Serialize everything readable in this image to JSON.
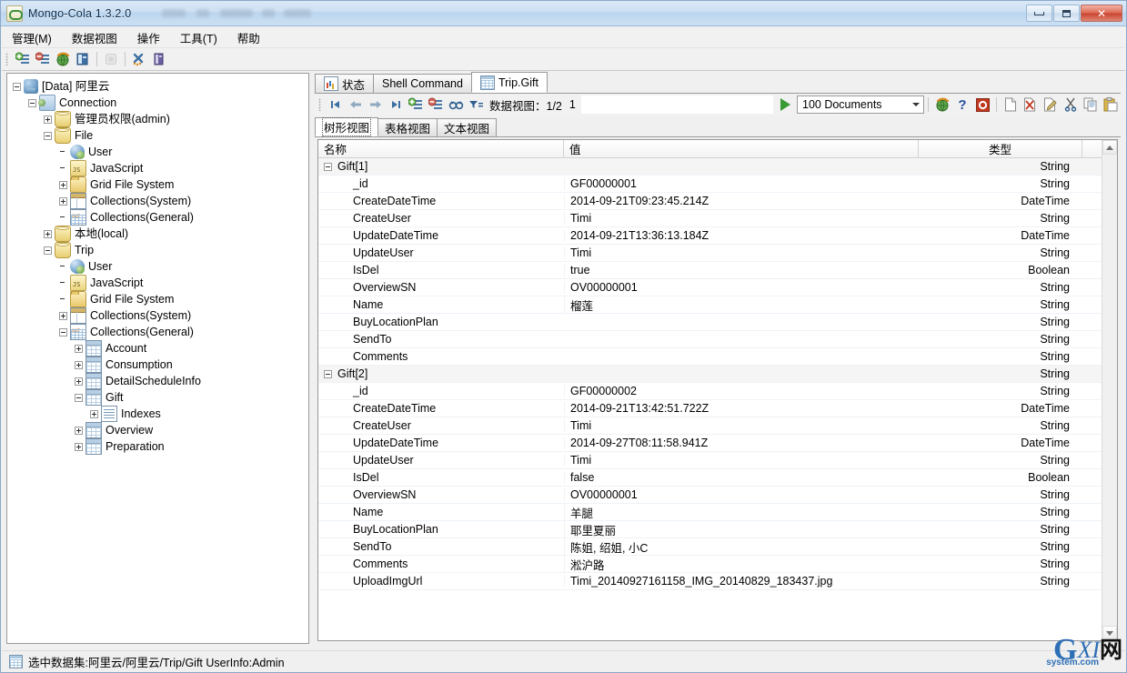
{
  "window": {
    "title": "Mongo-Cola  1.3.2.0",
    "app_icon": "mongo-cola-icon",
    "minimize_label": "Minimize",
    "maximize_label": "Maximize",
    "close_label": "Close"
  },
  "menubar": {
    "items": [
      {
        "label": "管理(M)",
        "name": "menu-manage"
      },
      {
        "label": "数据视图",
        "name": "menu-data-view"
      },
      {
        "label": "操作",
        "name": "menu-operation"
      },
      {
        "label": "工具(T)",
        "name": "menu-tools"
      },
      {
        "label": "帮助",
        "name": "menu-help"
      }
    ]
  },
  "toolbar": {
    "buttons": [
      {
        "name": "add-connection-icon",
        "title": "Add Connection"
      },
      {
        "name": "remove-connection-icon",
        "title": "Remove Connection"
      },
      {
        "name": "refresh-globe-icon",
        "title": "Refresh"
      },
      {
        "name": "database-icon",
        "title": "Database"
      },
      {
        "name": "stop-icon",
        "title": "Stop"
      },
      {
        "name": "tools-icon",
        "title": "Tools"
      },
      {
        "name": "options-icon",
        "title": "Options"
      }
    ]
  },
  "tree": {
    "nodes": [
      {
        "label": "[Data] 阿里云",
        "depth": 0,
        "expander": "minus",
        "icon": "ic-server",
        "name": "tree-node-data-aliyun"
      },
      {
        "label": "Connection",
        "depth": 1,
        "expander": "minus",
        "icon": "ic-conn",
        "name": "tree-node-connection"
      },
      {
        "label": "管理员权限(admin)",
        "depth": 2,
        "expander": "plus",
        "icon": "ic-db",
        "name": "tree-node-admin"
      },
      {
        "label": "File",
        "depth": 2,
        "expander": "minus",
        "icon": "ic-db",
        "name": "tree-node-file"
      },
      {
        "label": "User",
        "depth": 3,
        "expander": "none",
        "icon": "ic-user",
        "name": "tree-node-file-user"
      },
      {
        "label": "JavaScript",
        "depth": 3,
        "expander": "none",
        "icon": "ic-js",
        "name": "tree-node-file-javascript"
      },
      {
        "label": "Grid File System",
        "depth": 3,
        "expander": "plus",
        "icon": "ic-folder",
        "name": "tree-node-file-gridfs"
      },
      {
        "label": "Collections(System)",
        "depth": 3,
        "expander": "plus",
        "icon": "ic-gridsys",
        "name": "tree-node-file-collections-system"
      },
      {
        "label": "Collections(General)",
        "depth": 3,
        "expander": "none",
        "icon": "ic-gridgen",
        "name": "tree-node-file-collections-general"
      },
      {
        "label": "本地(local)",
        "depth": 2,
        "expander": "plus",
        "icon": "ic-db",
        "name": "tree-node-local"
      },
      {
        "label": "Trip",
        "depth": 2,
        "expander": "minus",
        "icon": "ic-db",
        "name": "tree-node-trip"
      },
      {
        "label": "User",
        "depth": 3,
        "expander": "none",
        "icon": "ic-user",
        "name": "tree-node-trip-user"
      },
      {
        "label": "JavaScript",
        "depth": 3,
        "expander": "none",
        "icon": "ic-js",
        "name": "tree-node-trip-javascript"
      },
      {
        "label": "Grid File System",
        "depth": 3,
        "expander": "none",
        "icon": "ic-folder",
        "name": "tree-node-trip-gridfs"
      },
      {
        "label": "Collections(System)",
        "depth": 3,
        "expander": "plus",
        "icon": "ic-gridsys",
        "name": "tree-node-trip-collections-system"
      },
      {
        "label": "Collections(General)",
        "depth": 3,
        "expander": "minus",
        "icon": "ic-gridgen",
        "name": "tree-node-trip-collections-general"
      },
      {
        "label": "Account",
        "depth": 4,
        "expander": "plus",
        "icon": "ic-coll",
        "name": "tree-node-account"
      },
      {
        "label": "Consumption",
        "depth": 4,
        "expander": "plus",
        "icon": "ic-coll",
        "name": "tree-node-consumption"
      },
      {
        "label": "DetailScheduleInfo",
        "depth": 4,
        "expander": "plus",
        "icon": "ic-coll",
        "name": "tree-node-detailscheduleinfo"
      },
      {
        "label": "Gift",
        "depth": 4,
        "expander": "minus",
        "icon": "ic-coll",
        "name": "tree-node-gift"
      },
      {
        "label": "Indexes",
        "depth": 5,
        "expander": "plus",
        "icon": "ic-index",
        "name": "tree-node-gift-indexes"
      },
      {
        "label": "Overview",
        "depth": 4,
        "expander": "plus",
        "icon": "ic-coll",
        "name": "tree-node-overview"
      },
      {
        "label": "Preparation",
        "depth": 4,
        "expander": "plus",
        "icon": "ic-coll",
        "name": "tree-node-preparation"
      }
    ]
  },
  "tabs": [
    {
      "label": "状态",
      "icon": "ic-status",
      "active": false,
      "name": "tab-status"
    },
    {
      "label": "Shell Command",
      "icon": "",
      "active": false,
      "name": "tab-shell-command"
    },
    {
      "label": "Trip.Gift",
      "icon": "ic-table",
      "active": true,
      "name": "tab-trip-gift"
    }
  ],
  "navbar": {
    "buttons": [
      {
        "name": "first-page-icon",
        "title": "First"
      },
      {
        "name": "previous-page-icon",
        "title": "Previous"
      },
      {
        "name": "next-page-icon",
        "title": "Next"
      },
      {
        "name": "last-page-icon",
        "title": "Last"
      },
      {
        "name": "add-document-icon",
        "title": "Add Document"
      },
      {
        "name": "remove-document-icon",
        "title": "Remove Document"
      },
      {
        "name": "find-icon",
        "title": "Find"
      },
      {
        "name": "filter-icon",
        "title": "Filter"
      }
    ],
    "page_label": "数据视图：1/2",
    "page_number": "1",
    "run_icon": "run-play-icon",
    "limit_value": "100  Documents",
    "right_buttons": [
      {
        "name": "refresh-globe-icon",
        "title": "Refresh"
      },
      {
        "name": "help-question-icon",
        "title": "Help"
      },
      {
        "name": "record-stop-icon",
        "title": "Stop"
      },
      {
        "name": "new-document-icon",
        "title": "New"
      },
      {
        "name": "delete-document-icon",
        "title": "Delete"
      },
      {
        "name": "edit-document-icon",
        "title": "Edit"
      },
      {
        "name": "cut-icon",
        "title": "Cut"
      },
      {
        "name": "copy-icon",
        "title": "Copy"
      },
      {
        "name": "paste-icon",
        "title": "Paste"
      }
    ]
  },
  "view_tabs": [
    {
      "label": "树形视图",
      "active": true,
      "name": "view-tab-tree"
    },
    {
      "label": "表格视图",
      "active": false,
      "name": "view-tab-table"
    },
    {
      "label": "文本视图",
      "active": false,
      "name": "view-tab-text"
    }
  ],
  "grid": {
    "columns": [
      "名称",
      "值",
      "类型"
    ],
    "rows": [
      {
        "group": true,
        "name": "Gift[1]",
        "value": "",
        "type": "String"
      },
      {
        "group": false,
        "name": "_id",
        "value": "GF00000001",
        "type": "String"
      },
      {
        "group": false,
        "name": "CreateDateTime",
        "value": "2014-09-21T09:23:45.214Z",
        "type": "DateTime"
      },
      {
        "group": false,
        "name": "CreateUser",
        "value": "Timi",
        "type": "String"
      },
      {
        "group": false,
        "name": "UpdateDateTime",
        "value": "2014-09-21T13:36:13.184Z",
        "type": "DateTime"
      },
      {
        "group": false,
        "name": "UpdateUser",
        "value": "Timi",
        "type": "String"
      },
      {
        "group": false,
        "name": "IsDel",
        "value": "true",
        "type": "Boolean"
      },
      {
        "group": false,
        "name": "OverviewSN",
        "value": "OV00000001",
        "type": "String"
      },
      {
        "group": false,
        "name": "Name",
        "value": "榴莲",
        "type": "String"
      },
      {
        "group": false,
        "name": "BuyLocationPlan",
        "value": "",
        "type": "String"
      },
      {
        "group": false,
        "name": "SendTo",
        "value": "",
        "type": "String"
      },
      {
        "group": false,
        "name": "Comments",
        "value": "",
        "type": "String"
      },
      {
        "group": true,
        "name": "Gift[2]",
        "value": "",
        "type": "String"
      },
      {
        "group": false,
        "name": "_id",
        "value": "GF00000002",
        "type": "String"
      },
      {
        "group": false,
        "name": "CreateDateTime",
        "value": "2014-09-21T13:42:51.722Z",
        "type": "DateTime"
      },
      {
        "group": false,
        "name": "CreateUser",
        "value": "Timi",
        "type": "String"
      },
      {
        "group": false,
        "name": "UpdateDateTime",
        "value": "2014-09-27T08:11:58.941Z",
        "type": "DateTime"
      },
      {
        "group": false,
        "name": "UpdateUser",
        "value": "Timi",
        "type": "String"
      },
      {
        "group": false,
        "name": "IsDel",
        "value": "false",
        "type": "Boolean"
      },
      {
        "group": false,
        "name": "OverviewSN",
        "value": "OV00000001",
        "type": "String"
      },
      {
        "group": false,
        "name": "Name",
        "value": "羊腿",
        "type": "String"
      },
      {
        "group": false,
        "name": "BuyLocationPlan",
        "value": "耶里夏丽",
        "type": "String"
      },
      {
        "group": false,
        "name": "SendTo",
        "value": "陈姐, 绍姐, 小C",
        "type": "String"
      },
      {
        "group": false,
        "name": "Comments",
        "value": "淞沪路",
        "type": "String"
      },
      {
        "group": false,
        "name": "UploadImgUrl",
        "value": "Timi_20140927161158_IMG_20140829_183437.jpg",
        "type": "String"
      }
    ]
  },
  "statusbar": {
    "icon": "dataset-icon",
    "text": "选中数据集:阿里云/阿里云/Trip/Gift  UserInfo:Admin"
  },
  "watermark": {
    "g": "G",
    "xi": "XI",
    "cn": "网",
    "sub": "system.com"
  },
  "colors": {
    "title_accent": "#bcd6ef",
    "close_button": "#c9422f",
    "run_green": "#3a9a34",
    "group_row": "#f5f5f5"
  }
}
